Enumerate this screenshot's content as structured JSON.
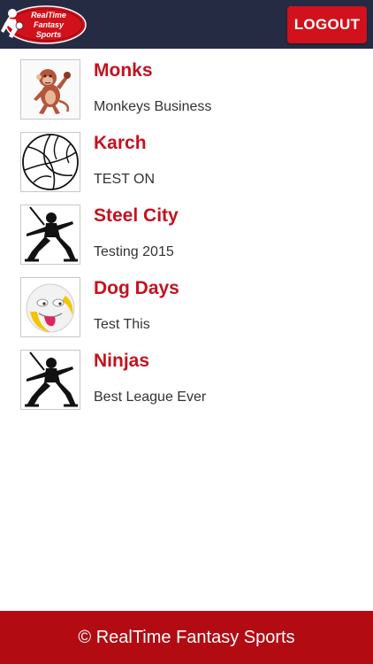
{
  "app": {
    "logo_text": [
      "RealTime",
      "Fantasy",
      "Sports"
    ],
    "logout_label": "LOGOUT"
  },
  "leagues": [
    {
      "name": "Monks",
      "description": "Monkeys Business",
      "icon": "monkey-icon"
    },
    {
      "name": "Karch",
      "description": "TEST ON",
      "icon": "volleyball-icon"
    },
    {
      "name": "Steel City",
      "description": "Testing 2015",
      "icon": "ninja-icon"
    },
    {
      "name": "Dog Days",
      "description": "Test This",
      "icon": "smiley-tongue-icon"
    },
    {
      "name": "Ninjas",
      "description": "Best League Ever",
      "icon": "ninja-icon"
    }
  ],
  "footer": {
    "copyright": "© RealTime Fantasy Sports"
  },
  "colors": {
    "header_bg": "#262b44",
    "accent_red": "#d1111b",
    "league_name": "#c4121f",
    "footer_bg": "#b20b12"
  }
}
